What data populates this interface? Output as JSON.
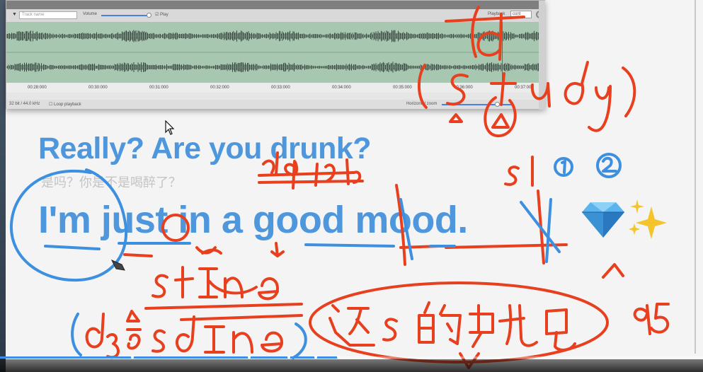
{
  "editor": {
    "track_name_placeholder": "Track name",
    "volume_label": "Volume",
    "play_label": "Play",
    "playback_label": "Playback",
    "playback_value": "cont",
    "time_ticks": [
      "00:28:000",
      "00:30:000",
      "00:31:000",
      "00:32:000",
      "00:33:000",
      "00:34:000",
      "00:35:000",
      "00:36:000",
      "00:37:000"
    ],
    "status_format": "32 bit / 44.0 kHz",
    "loop_label": "Loop playback",
    "zoom_label": "Horizontal zoom"
  },
  "lesson": {
    "question": "Really? Are you drunk?",
    "translation": "是吗？你是不是喝醉了？",
    "answer": "I'm just in a good mood."
  },
  "icons": {
    "gem": "gem-icon",
    "sparkle": "sparkle-icon",
    "cursor": "cursor-icon",
    "pen": "pen-icon"
  },
  "annotations": {
    "phonetic_top": "d",
    "study_word": "(study)",
    "circled_1": "①",
    "circled_2": "②",
    "s_one": "s1",
    "number_95": "95",
    "good_phonetic": "d g d",
    "st_in_a": "stIn ə",
    "long_phonetic": "(dʒʌsdInə)",
    "chinese_note": "这s的呢"
  },
  "video": {
    "progress_fraction": 0.48
  },
  "colors": {
    "text_blue": "#4f97dc",
    "ink_red": "#e8401f",
    "ink_blue": "#3d8fe0",
    "waveform_bg": "#a7c7b0"
  }
}
